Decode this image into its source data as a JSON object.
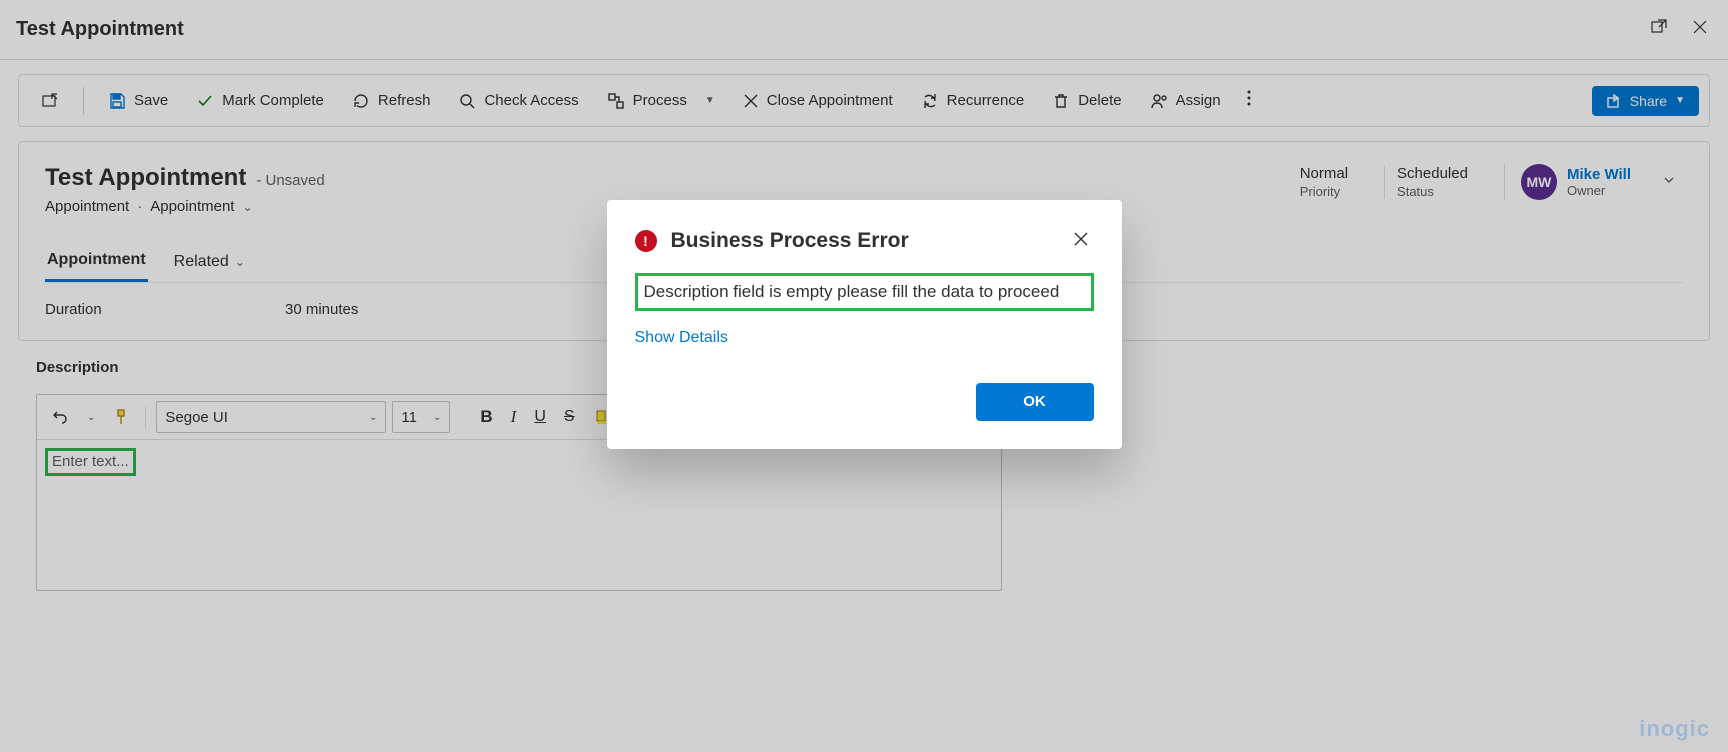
{
  "header": {
    "title": "Test Appointment"
  },
  "commands": {
    "save": "Save",
    "mark_complete": "Mark Complete",
    "refresh": "Refresh",
    "check_access": "Check Access",
    "process": "Process",
    "close_appointment": "Close Appointment",
    "recurrence": "Recurrence",
    "delete": "Delete",
    "assign": "Assign",
    "share": "Share"
  },
  "record": {
    "title": "Test Appointment",
    "unsaved": "- Unsaved",
    "entity": "Appointment",
    "form": "Appointment",
    "meta": {
      "priority": {
        "value": "Normal",
        "label": "Priority"
      },
      "status": {
        "value": "Scheduled",
        "label": "Status"
      },
      "owner": {
        "initials": "MW",
        "name": "Mike Will",
        "label": "Owner"
      }
    }
  },
  "tabs": {
    "appointment": "Appointment",
    "related": "Related"
  },
  "fields": {
    "duration": {
      "label": "Duration",
      "value": "30 minutes"
    },
    "description": {
      "label": "Description"
    }
  },
  "rte": {
    "font": "Segoe UI",
    "size": "11",
    "placeholder": "Enter text..."
  },
  "modal": {
    "title": "Business Process Error",
    "message": "Description field is empty please fill the data to proceed",
    "show_details": "Show Details",
    "ok": "OK"
  },
  "watermark": "inogic"
}
